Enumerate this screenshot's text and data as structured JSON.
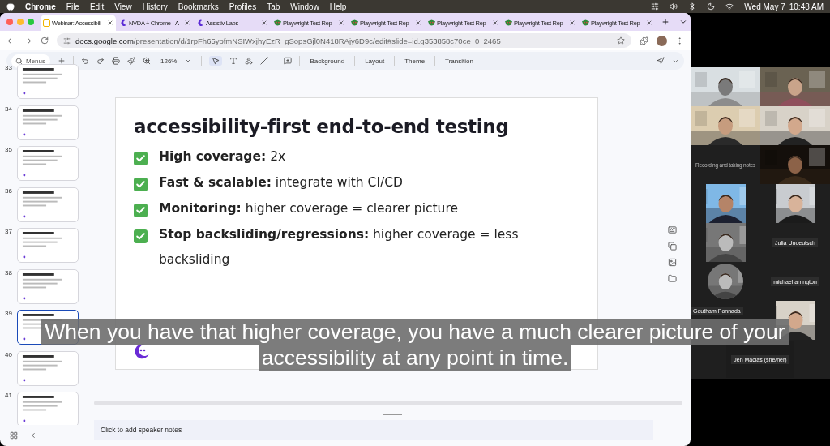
{
  "menubar": {
    "app": "Chrome",
    "menus": [
      "File",
      "Edit",
      "View",
      "History",
      "Bookmarks",
      "Profiles",
      "Tab",
      "Window",
      "Help"
    ],
    "date": "Wed May 7",
    "time": "10:48 AM"
  },
  "tabs": [
    {
      "title": "Webinar: Accessibili",
      "selected": true
    },
    {
      "title": "NVDA + Chrome - A",
      "selected": false
    },
    {
      "title": "Assistiv Labs",
      "selected": false
    },
    {
      "title": "Playwright Test Rep",
      "selected": false
    },
    {
      "title": "Playwright Test Rep",
      "selected": false
    },
    {
      "title": "Playwright Test Rep",
      "selected": false
    },
    {
      "title": "Playwright Test Rep",
      "selected": false
    },
    {
      "title": "Playwright Test Rep",
      "selected": false
    }
  ],
  "address": {
    "host": "docs.google.com",
    "path": "/presentation/d/1rpFh65yofmNSIWxjhyEzR_gSopsGjl0N418RAjy6D9c/edit#slide=id.g353858c70ce_0_2465"
  },
  "toolbar": {
    "search_placeholder": "Menus",
    "zoom": "126%",
    "buttons": [
      "Background",
      "Layout",
      "Theme",
      "Transition"
    ]
  },
  "slides": [
    {
      "number": "33",
      "selected": false
    },
    {
      "number": "34",
      "selected": false
    },
    {
      "number": "35",
      "selected": false
    },
    {
      "number": "36",
      "selected": false
    },
    {
      "number": "37",
      "selected": false
    },
    {
      "number": "38",
      "selected": false
    },
    {
      "number": "39",
      "selected": true
    },
    {
      "number": "40",
      "selected": false
    },
    {
      "number": "41",
      "selected": false
    }
  ],
  "slide": {
    "title": "accessibility-first end-to-end testing",
    "bullets": [
      {
        "label": "High coverage:",
        "text": "2x"
      },
      {
        "label": "Fast & scalable:",
        "text": "integrate with CI/CD"
      },
      {
        "label": "Monitoring:",
        "text": "higher coverage = clearer picture"
      },
      {
        "label": "Stop backsliding/regressions:",
        "text": "higher coverage = less backsliding"
      }
    ]
  },
  "speaker_notes": {
    "placeholder": "Click to add speaker notes"
  },
  "participants": [
    {
      "kind": "video"
    },
    {
      "kind": "video"
    },
    {
      "kind": "video"
    },
    {
      "kind": "video"
    },
    {
      "kind": "notes",
      "text": "Recording and taking notes"
    },
    {
      "kind": "video"
    },
    {
      "kind": "inset"
    },
    {
      "kind": "inset"
    },
    {
      "kind": "inset"
    },
    {
      "kind": "name",
      "name": "Julia Undeutsch"
    },
    {
      "kind": "portrait"
    },
    {
      "kind": "name",
      "name": "michael arrington"
    },
    {
      "kind": "name",
      "name": "Goutham Ponnada"
    },
    {
      "kind": "inset"
    },
    {
      "kind": "wide_name",
      "name": "Jen Macias (she/her)"
    }
  ],
  "captions": [
    "When you have that higher coverage, you have a much clearer picture of your",
    "accessibility at any point in time."
  ]
}
